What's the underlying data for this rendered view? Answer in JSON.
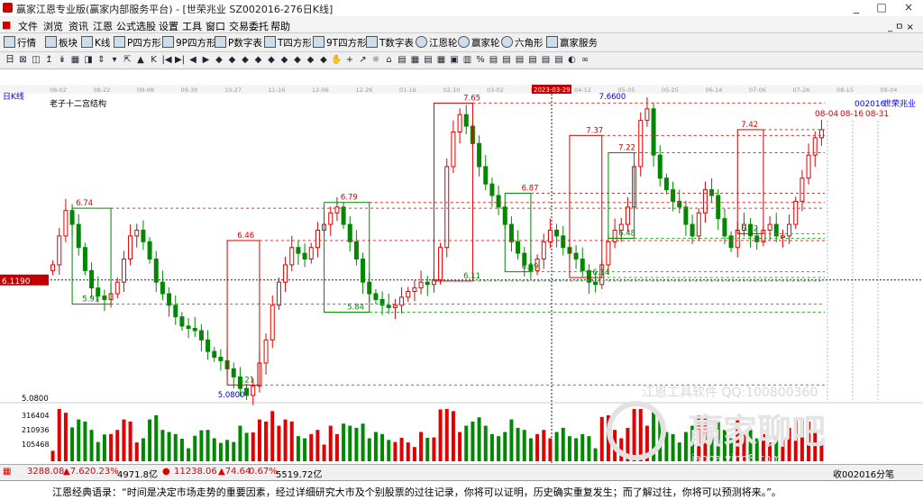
{
  "title": "赢家江恩专业版(赢家内部服务平台) - [世荣兆业  SZ002016-276日K线]",
  "menu": [
    "文件",
    "浏览",
    "资讯",
    "江恩",
    "公式选股",
    "设置",
    "工具",
    "窗口",
    "交易委托",
    "帮助"
  ],
  "toolbar1": [
    "行情",
    "板块",
    "K线",
    "P四方形",
    "9P四方形",
    "P数字表",
    "T四方形",
    "9T四方形",
    "T数字表",
    "江恩轮",
    "赢家轮",
    "六角形",
    "赢家服务"
  ],
  "win_buttons": [
    "_",
    "□",
    "×"
  ],
  "inner_win_buttons": "_ ㅁ ×",
  "toolbar2_icons": [
    "日",
    "⊠",
    "◫",
    "↥",
    "↡",
    "▦",
    "◨",
    "⇕",
    "▾",
    "⇱",
    "▲",
    "K",
    "|◀",
    "▶|",
    "◀",
    "▶",
    "◆",
    "◆",
    "◆",
    "◆",
    "◆",
    "◆",
    "◆",
    "◆",
    "◆",
    "✋",
    "+",
    "↗",
    "☼",
    "⌂",
    "▤",
    "▦",
    "▤",
    "▦",
    "▣",
    "▥",
    "%",
    "▤",
    "▤",
    "▤",
    "▤",
    "▤",
    "▤",
    "◐",
    "∞"
  ],
  "chart_data": {
    "type": "candlestick",
    "period_label": "日K线",
    "study_label": "老子十二宫结构",
    "stock_code": "002016",
    "stock_name": "世荣兆业",
    "x_tick_labels": [
      "08-02",
      "08-22",
      "09-08",
      "09-30",
      "10-27",
      "11-16",
      "12-06",
      "12-26",
      "01-16",
      "02-10",
      "03-02",
      "03-22",
      "04-12",
      "05-05",
      "05-25",
      "06-14",
      "07-06",
      "07-26",
      "08-15",
      "09-04"
    ],
    "cursor_date": "2023-03-29",
    "ylim": [
      5.08,
      7.7
    ],
    "price_axis_label": "5.0800",
    "crosshair_price": "6.1190",
    "marked_values": [
      "6.74",
      "5.91",
      "6.46",
      "5.21",
      "5.0800",
      "6.79",
      "5.84",
      "7.65",
      "6.11",
      "6.87",
      "6.19",
      "7.6600",
      "7.37",
      "6.14",
      "7.22",
      "6.48",
      "7.42",
      "6.52"
    ],
    "future_dates": [
      "08-04",
      "08-16",
      "08-31"
    ],
    "closes": [
      6.25,
      6.5,
      6.72,
      6.6,
      6.4,
      6.2,
      6.05,
      5.98,
      5.95,
      6.0,
      6.1,
      6.3,
      6.5,
      6.55,
      6.45,
      6.3,
      6.1,
      6.0,
      5.9,
      5.8,
      5.72,
      5.7,
      5.68,
      5.6,
      5.5,
      5.45,
      5.42,
      5.35,
      5.28,
      5.18,
      5.12,
      5.2,
      5.4,
      5.6,
      5.9,
      6.1,
      6.25,
      6.4,
      6.35,
      6.3,
      6.4,
      6.55,
      6.6,
      6.7,
      6.75,
      6.6,
      6.45,
      6.3,
      6.1,
      6.0,
      5.95,
      5.9,
      5.88,
      5.9,
      5.97,
      6.02,
      6.05,
      6.1,
      6.08,
      6.12,
      6.4,
      7.1,
      7.4,
      7.55,
      7.45,
      7.3,
      7.1,
      6.95,
      6.85,
      6.75,
      6.6,
      6.45,
      6.35,
      6.25,
      6.2,
      6.3,
      6.45,
      6.55,
      6.5,
      6.4,
      6.35,
      6.3,
      6.2,
      6.1,
      6.08,
      6.25,
      6.45,
      6.55,
      6.6,
      6.75,
      7.1,
      7.5,
      7.6,
      7.2,
      7.0,
      6.9,
      6.8,
      6.75,
      6.6,
      6.5,
      6.7,
      6.9,
      6.85,
      6.65,
      6.5,
      6.4,
      6.55,
      6.6,
      6.5,
      6.45,
      6.55,
      6.6,
      6.5,
      6.5,
      6.6,
      6.8,
      7.0,
      7.2,
      7.35,
      7.42
    ],
    "volume_axis": [
      "316404",
      "210936",
      "105468"
    ]
  },
  "watermark": {
    "company": "江恩工具软件  QQ:100800360",
    "brand": "赢家聊吧",
    "url": "jiaoba.ying8.com"
  },
  "status": {
    "sh_index": "3288.08",
    "sh_change": "▲7.62",
    "sh_pct": "0.23%",
    "sh_amount": "4971.8亿",
    "sz_index": "11238.06",
    "sz_change": "▲74.64",
    "sz_pct": "0.67%",
    "sz_amount": "5519.72亿",
    "right": "收002016分笔"
  },
  "quote": "江恩经典语录：“时间是决定市场走势的重要因素，经过详细研究大市及个别股票的过往记录，你将可以证明，历史确实重复发生；而了解过往，你将可以预测将来。”。",
  "colors": {
    "up": "#e00000",
    "down": "#008800",
    "box_red": "#d80000",
    "box_green": "#008800",
    "line_blue": "#0000cc",
    "accent": "#cc0000"
  }
}
